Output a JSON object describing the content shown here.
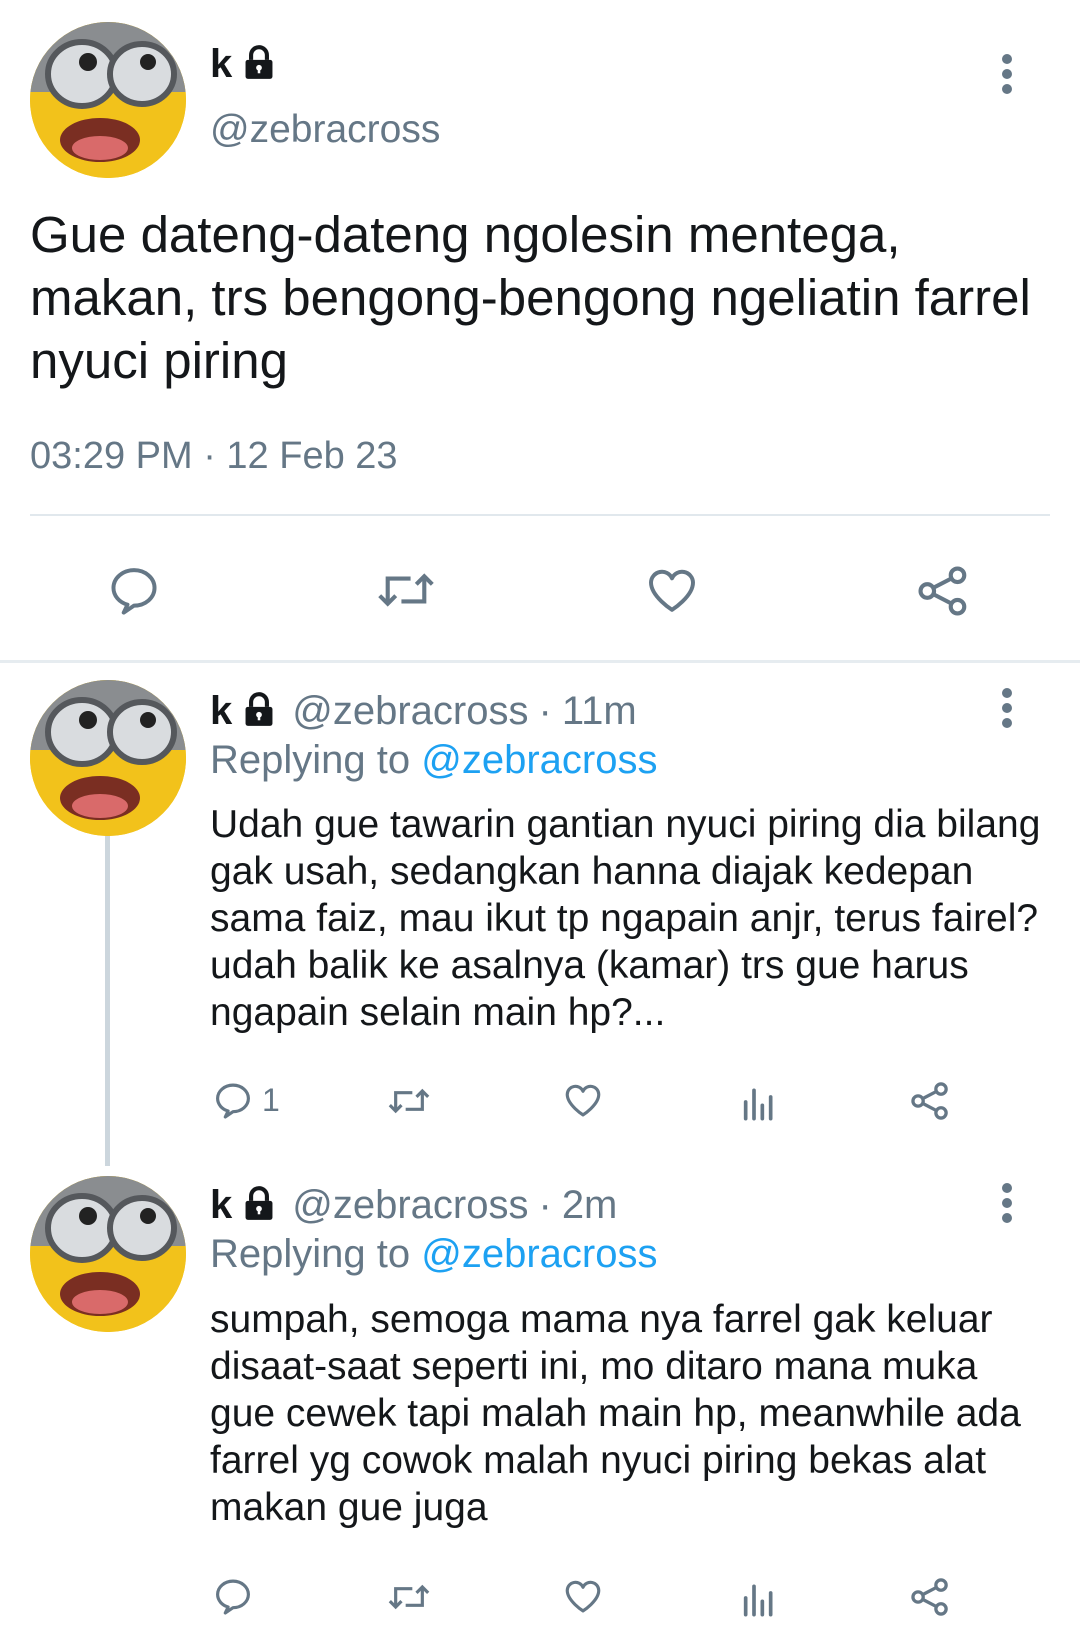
{
  "colors": {
    "accent": "#1da1f2",
    "muted": "#657786",
    "text": "#14171a",
    "divider": "#e1e8ed",
    "thread_line": "#ccd6dd",
    "avatar_yellow": "#f2c21b"
  },
  "main_tweet": {
    "name": "k",
    "handle": "@zebracross",
    "text": "Gue dateng-dateng ngolesin mentega, makan, trs bengong-bengong ngeliatin farrel nyuci piring",
    "timestamp": "03:29 PM · 12 Feb 23",
    "actions": [
      "reply-icon",
      "retweet-icon",
      "like-icon",
      "share-icon"
    ]
  },
  "replies": [
    {
      "name": "k",
      "handle": "@zebracross",
      "separator": "·",
      "time": "11m",
      "replying_prefix": "Replying to",
      "replying_to": "@zebracross",
      "text": "Udah gue tawarin gantian nyuci piring dia bilang gak usah, sedangkan hanna diajak kedepan sama faiz, mau ikut tp ngapain anjr, terus fairel? udah balik ke asalnya (kamar) trs gue harus ngapain selain main hp?...",
      "reply_count": "1"
    },
    {
      "name": "k",
      "handle": "@zebracross",
      "separator": "·",
      "time": "2m",
      "replying_prefix": "Replying to",
      "replying_to": "@zebracross",
      "text": "sumpah, semoga mama nya farrel gak keluar disaat-saat seperti ini, mo ditaro mana muka gue cewek tapi malah main hp, meanwhile ada farrel yg cowok malah nyuci piring bekas alat makan gue juga",
      "reply_count": ""
    }
  ]
}
